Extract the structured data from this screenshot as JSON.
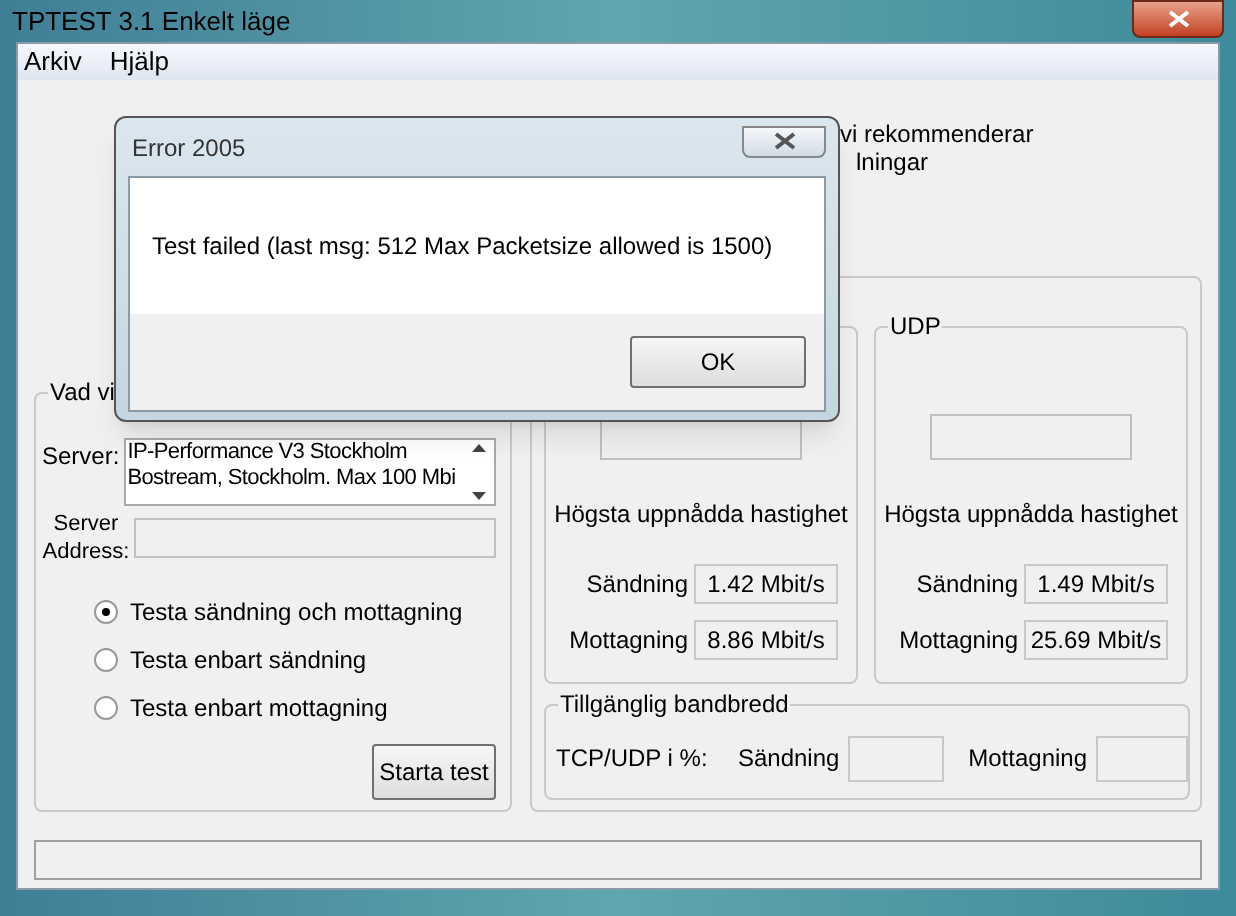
{
  "window": {
    "title": "TPTEST 3.1 Enkelt läge"
  },
  "menu": [
    "Arkiv",
    "Hjälp"
  ],
  "intro_lines": [
    "vi rekommenderar",
    "lningar"
  ],
  "test_group": {
    "title": "Vad vi",
    "server_label": "Server:",
    "servers": [
      "IP-Performance V3 Stockholm",
      "Bostream, Stockholm. Max 100 Mbi"
    ],
    "address_label": "Server Address:",
    "modes": [
      {
        "label": "Testa sändning och mottagning",
        "selected": true
      },
      {
        "label": "Testa enbart sändning",
        "selected": false
      },
      {
        "label": "Testa enbart mottagning",
        "selected": false
      }
    ],
    "start_button": "Starta test"
  },
  "results": [
    {
      "heading": "Högsta uppnådda hastighet",
      "rows": [
        {
          "label": "Sändning",
          "value": "1.42 Mbit/s"
        },
        {
          "label": "Mottagning",
          "value": "8.86 Mbit/s"
        }
      ]
    },
    {
      "title": "UDP",
      "heading": "Högsta uppnådda hastighet",
      "rows": [
        {
          "label": "Sändning",
          "value": "1.49 Mbit/s"
        },
        {
          "label": "Mottagning",
          "value": "25.69 Mbit/s"
        }
      ]
    }
  ],
  "bandwidth": {
    "title": "Tillgänglig bandbredd",
    "label": "TCP/UDP i %:",
    "send_label": "Sändning",
    "receive_label": "Mottagning"
  },
  "dialog": {
    "title": "Error 2005",
    "message": "Test failed  (last msg: 512 Max Packetsize allowed is 1500)",
    "button": "OK"
  }
}
